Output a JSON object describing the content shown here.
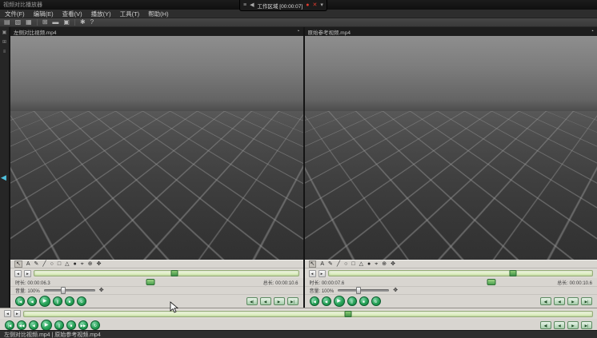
{
  "window": {
    "title": "视频对比播放器"
  },
  "menu": {
    "items": [
      "文件(F)",
      "编辑(E)",
      "查看(V)",
      "播放(Y)",
      "工具(T)",
      "帮助(H)"
    ]
  },
  "center_toolbar": {
    "label": "工作区域 [00:00:07]"
  },
  "icons": {
    "menu": "≡",
    "back": "◀",
    "fwd": "▶",
    "record": "●",
    "close": "✕",
    "pin": "▾",
    "doc": "▤",
    "folder": "▧",
    "save": "▦",
    "grid": "⊞",
    "film": "▬",
    "camera": "▣",
    "gear": "✱",
    "help": "?",
    "cursor": "↖",
    "text": "A",
    "pencil": "✎",
    "line": "╱",
    "ellipse": "○",
    "rect": "□",
    "tri": "△",
    "color": "●",
    "target": "⌖",
    "zoom": "⊕",
    "pan": "✥",
    "step_l": "◄",
    "step_r": "►",
    "t_start": "|◀",
    "t_rew": "◀◀",
    "t_prev": "◀",
    "t_play": "▶",
    "t_pause": "||",
    "t_stop": "■",
    "t_ff": "▶▶",
    "t_loop": "↻",
    "f_start": "◀|",
    "f_prev": "◀",
    "f_next": "▶",
    "f_end": "▶|",
    "clock": "◔",
    "collapse": "◀"
  },
  "pane_left": {
    "title": "左侧对比视频.mp4",
    "progress_pct": 53,
    "marker_pct": 47,
    "time_label": "时长: 00:00:06.3",
    "total_label": "总长: 00:00:10.6",
    "volume_label": "音量: 100%",
    "volume_pct": 38
  },
  "pane_right": {
    "title": "原始参考视频.mp4",
    "progress_pct": 70,
    "marker_pct": 70,
    "time_label": "时长: 00:00:07.6",
    "total_label": "总长: 00:00:10.6",
    "volume_label": "音量: 100%",
    "volume_pct": 41
  },
  "global_controls": {
    "progress_pct": 57
  },
  "status_bar": {
    "text": "左侧对比视频.mp4  |  原始参考视频.mp4"
  },
  "colors": {
    "accent_green": "#3f9e4d",
    "timeline_green": "#cfe6ab",
    "fire_orange": "#ff8a1e",
    "panel_gray": "#d8d5d0"
  }
}
